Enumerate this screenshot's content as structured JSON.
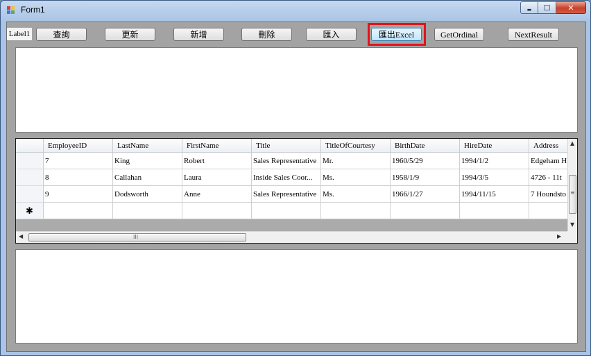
{
  "window": {
    "title": "Form1",
    "minimize_glyph": "▬",
    "maximize_glyph": "☐",
    "close_glyph": "✕"
  },
  "toolbar": {
    "label1": "Label1",
    "query_label": "查詢",
    "update_label": "更新",
    "add_label": "新增",
    "delete_label": "刪除",
    "import_label": "匯入",
    "export_excel_label": "匯出Excel",
    "get_ordinal_label": "GetOrdinal",
    "next_result_label": "NextResult"
  },
  "grid": {
    "columns": [
      "EmployeeID",
      "LastName",
      "FirstName",
      "Title",
      "TitleOfCourtesy",
      "BirthDate",
      "HireDate",
      "Address"
    ],
    "rows": [
      [
        "7",
        "King",
        "Robert",
        "Sales Representative",
        "Mr.",
        "1960/5/29",
        "1994/1/2",
        "Edgeham H"
      ],
      [
        "8",
        "Callahan",
        "Laura",
        "Inside Sales Coor...",
        "Ms.",
        "1958/1/9",
        "1994/3/5",
        "4726 - 11t"
      ],
      [
        "9",
        "Dodsworth",
        "Anne",
        "Sales Representative",
        "Ms.",
        "1966/1/27",
        "1994/11/15",
        "7 Houndsto"
      ]
    ],
    "new_row_marker": "✱",
    "scroll": {
      "up_arrow": "▲",
      "down_arrow": "▼",
      "left_arrow": "◀",
      "right_arrow": "▶",
      "grip": "≡",
      "hgrip": "III"
    }
  },
  "colors": {
    "highlight": "#e0141e",
    "focused_button": "#3c7fb1"
  }
}
